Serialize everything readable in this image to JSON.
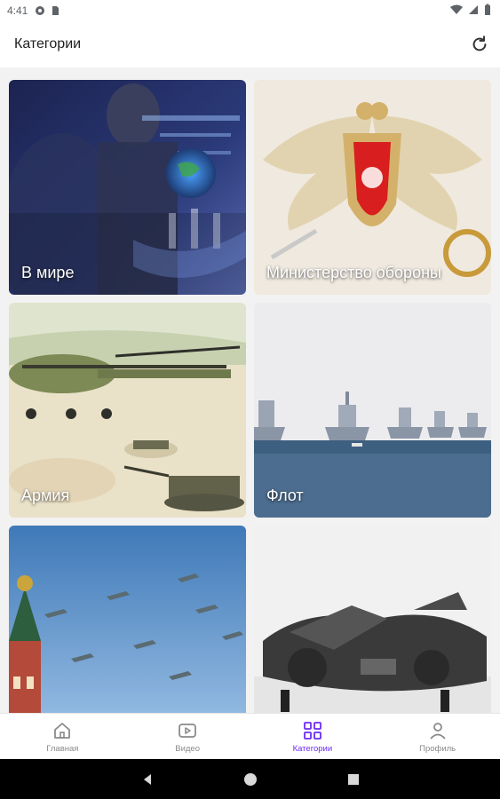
{
  "status_bar": {
    "time": "4:41",
    "left_icons": [
      "sync-icon",
      "sim-icon"
    ],
    "right_icons": [
      "wifi-icon",
      "signal-icon",
      "battery-icon"
    ]
  },
  "header": {
    "title": "Категории",
    "refresh_icon": "refresh-icon"
  },
  "categories": [
    {
      "label": "В мире"
    },
    {
      "label": "Министерство обороны"
    },
    {
      "label": "Армия"
    },
    {
      "label": "Флот"
    },
    {
      "label": ""
    },
    {
      "label": ""
    }
  ],
  "bottom_nav": {
    "items": [
      {
        "label": "Главная",
        "icon": "home-icon",
        "active": false
      },
      {
        "label": "Видео",
        "icon": "video-icon",
        "active": false
      },
      {
        "label": "Категории",
        "icon": "grid-icon",
        "active": true
      },
      {
        "label": "Профиль",
        "icon": "person-icon",
        "active": false
      }
    ]
  },
  "system_nav": [
    "back-icon",
    "home-circle-icon",
    "recents-icon"
  ],
  "colors": {
    "accent": "#6c2cf6",
    "inactive": "#8a8a8a",
    "content_bg": "#f2f2f2"
  }
}
